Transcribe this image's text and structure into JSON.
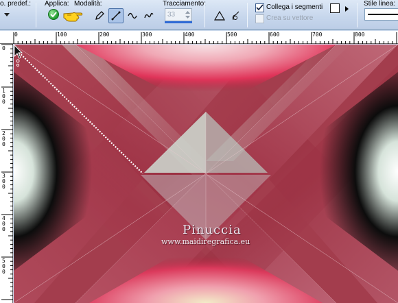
{
  "toolbar": {
    "preset_label": "o. predef.:",
    "apply_label": "Applica:",
    "mode_label": "Modalità:",
    "tracking_label": "Tracciamento:",
    "tracking_value": "33",
    "connect_segments_label": "Collega i segmenti",
    "connect_segments_checked": true,
    "create_on_vector_label": "Crea su vettore",
    "create_on_vector_checked": false,
    "line_style_label": "Stile linea:",
    "icons": [
      "chevron-down-icon",
      "apply-check-icon",
      "pointing-hand-icon",
      "pen-icon",
      "line-segment-icon",
      "bezier-curve-icon",
      "freehand-icon",
      "node-edit-icon",
      "contour-icon"
    ]
  },
  "ruler_top": {
    "labels": [
      "0",
      "100",
      "200",
      "300",
      "400",
      "500",
      "600",
      "700",
      "800"
    ]
  },
  "ruler_left": {
    "labels": [
      "0",
      "100",
      "200",
      "300",
      "400",
      "500"
    ]
  },
  "canvas": {
    "watermark_title": "Pinuccia",
    "watermark_url": "www.maidiregrafica.eu",
    "colors": {
      "crimson": "#a8404f",
      "dark_red": "#7a1f2e",
      "silver": "#c9d4cc",
      "pink_glow": "#f05a78",
      "black": "#0c0c0c"
    }
  }
}
